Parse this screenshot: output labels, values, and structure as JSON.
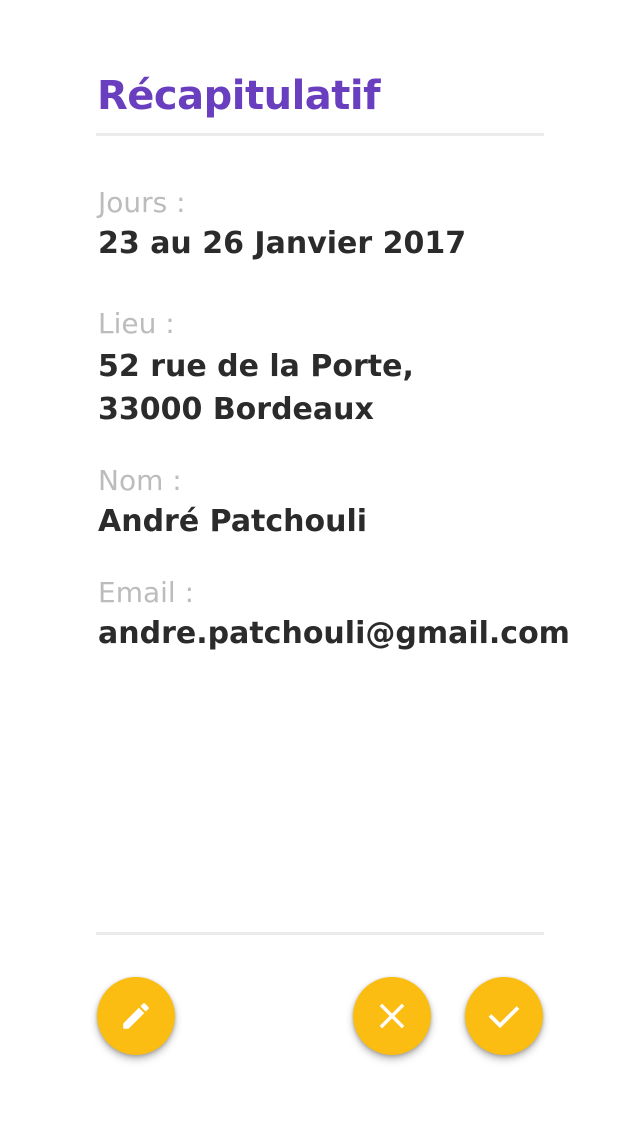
{
  "summary": {
    "title": "Récapitulatif",
    "fields": [
      {
        "label": "Jours :",
        "value_lines": [
          "23 au 26 Janvier 2017"
        ]
      },
      {
        "label": "Lieu :",
        "value_lines": [
          "52 rue de la Porte,",
          "33000 Bordeaux"
        ]
      },
      {
        "label": "Nom :",
        "value_lines": [
          "André Patchouli"
        ]
      },
      {
        "label": "Email :",
        "value_lines": [
          "andre.patchouli@gmail.com"
        ]
      }
    ]
  },
  "actions": {
    "edit_icon": "pencil-icon",
    "cancel_icon": "close-icon",
    "confirm_icon": "check-icon"
  },
  "colors": {
    "title": "#6a3fbf",
    "label": "#bcbcbc",
    "value": "#2b2b2b",
    "divider": "#ebebeb",
    "fab": "#fcbd12",
    "fab_icon": "#ffffff"
  }
}
